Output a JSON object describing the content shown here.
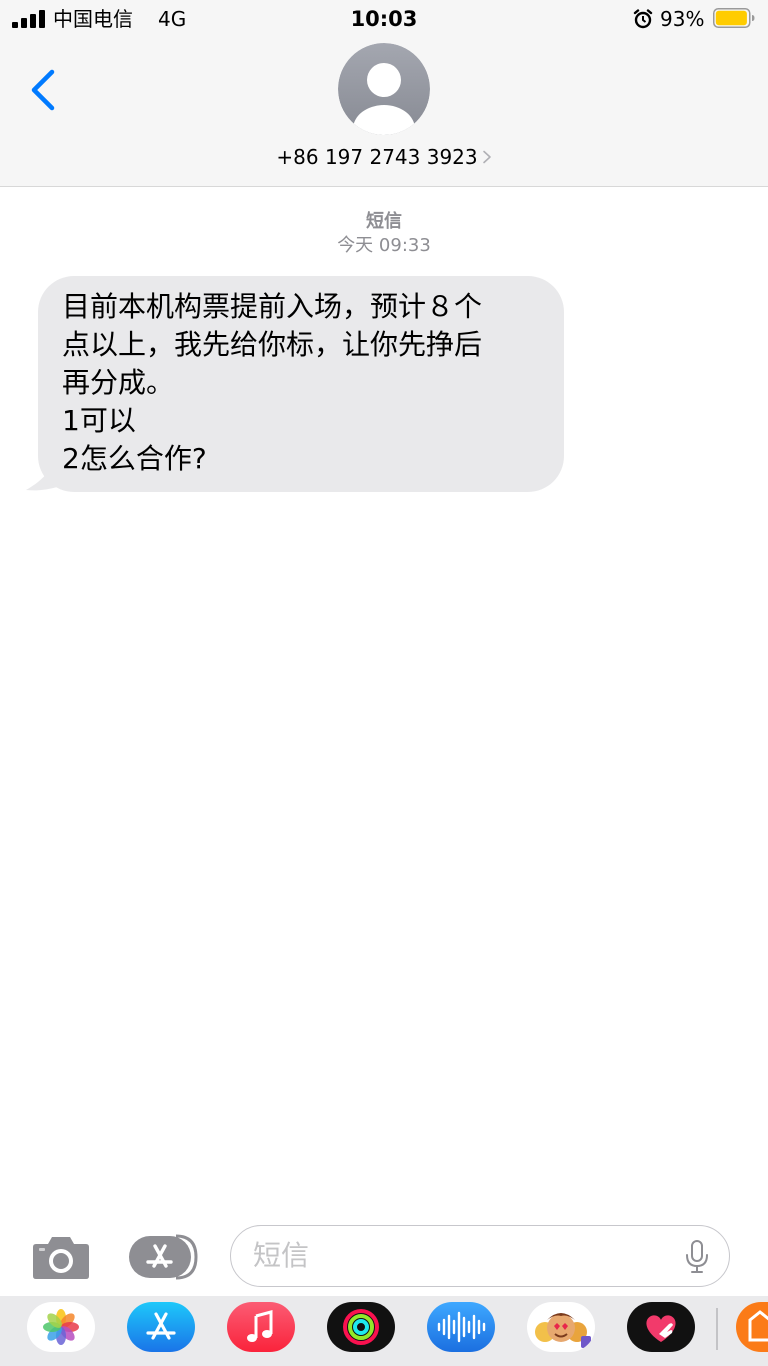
{
  "status_bar": {
    "carrier": "中国电信",
    "network": "4G",
    "time": "10:03",
    "battery_percent": "93%",
    "battery_level": 0.93,
    "signal_bars": 4
  },
  "header": {
    "contact_number": "+86 197 2743 3923"
  },
  "conversation": {
    "service_label": "短信",
    "timestamp": "今天 09:33",
    "messages": [
      {
        "direction": "incoming",
        "lines": [
          "目前本机构票提前入场，预计８个",
          "点以上，我先给你标，让你先挣后",
          "再分成。",
          "1可以",
          "2怎么合作?"
        ]
      }
    ]
  },
  "input_bar": {
    "placeholder": "短信"
  },
  "app_tray": {
    "apps": [
      "photos-app",
      "app-store-app",
      "music-app",
      "activity-app",
      "voice-memos-app",
      "memoji-app",
      "digital-touch-app",
      "partial-app"
    ]
  },
  "colors": {
    "accent": "#007aff",
    "bubble_incoming": "#e9e9eb",
    "header_bg": "#f6f6f6",
    "meta_text": "#8e8e93",
    "battery_fill": "#ffcc00"
  }
}
